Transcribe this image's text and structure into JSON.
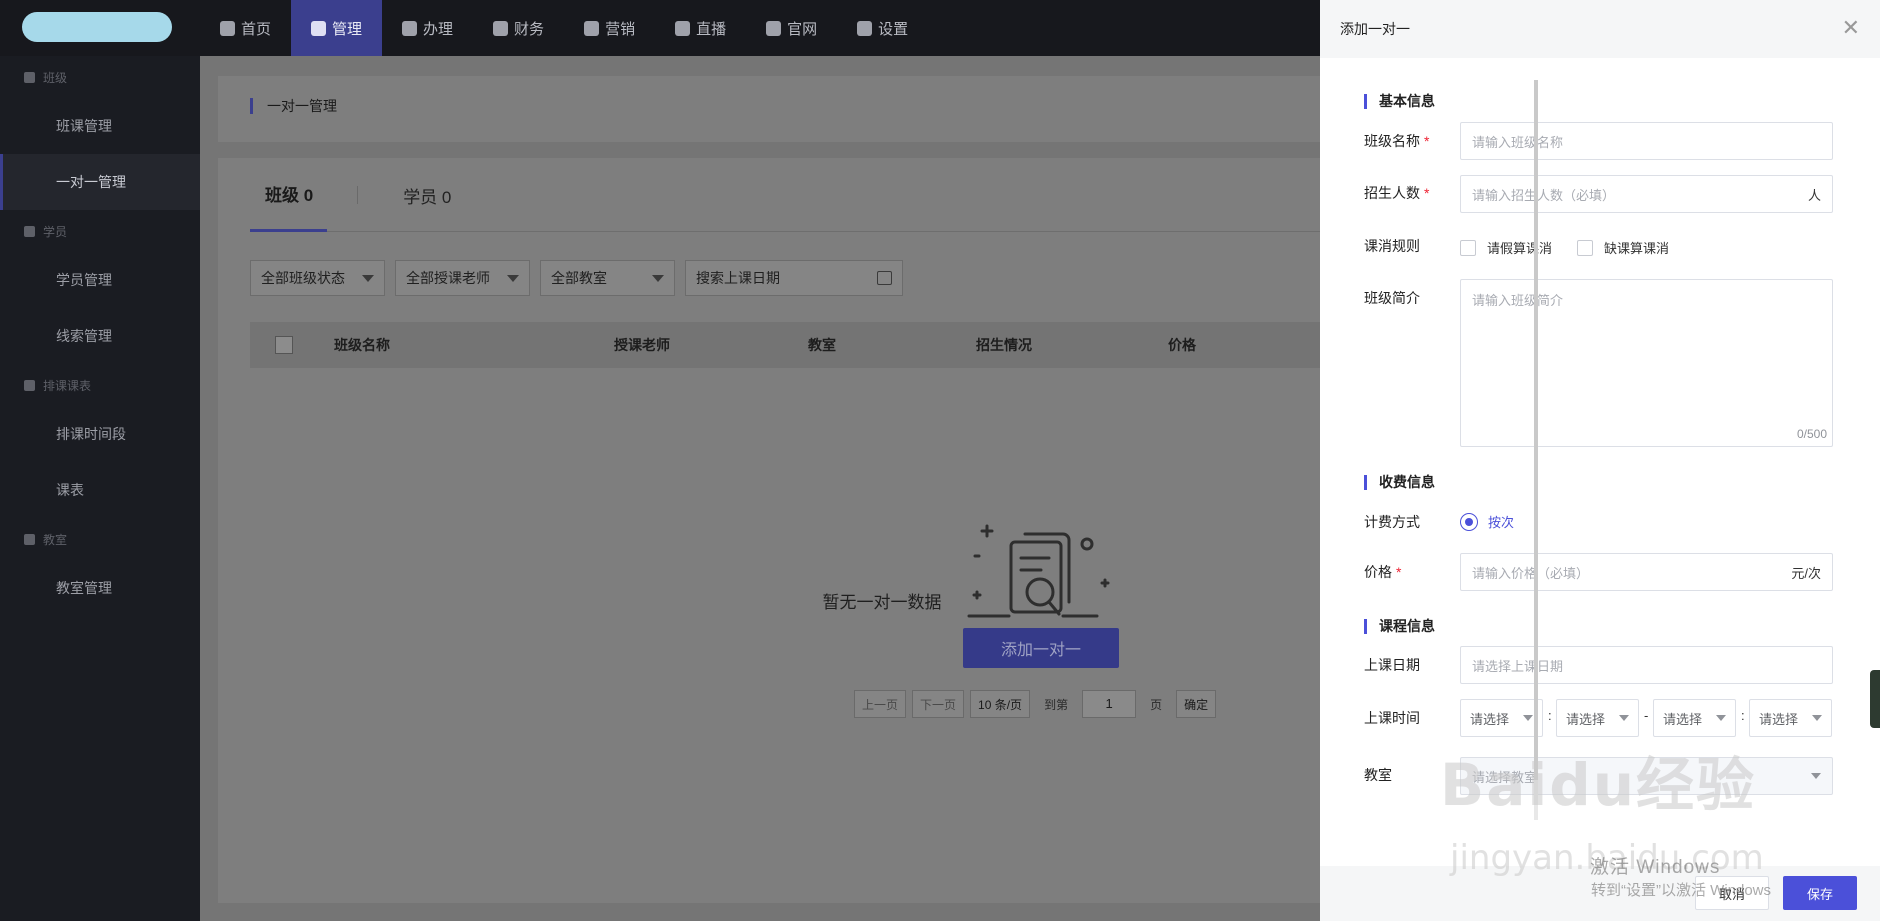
{
  "topnav": {
    "items": [
      {
        "label": "首页",
        "icon": "home-icon"
      },
      {
        "label": "管理",
        "icon": "shield-icon",
        "active": true
      },
      {
        "label": "办理",
        "icon": "graduation-cap-icon"
      },
      {
        "label": "财务",
        "icon": "money-bag-icon"
      },
      {
        "label": "营销",
        "icon": "marketing-icon"
      },
      {
        "label": "直播",
        "icon": "live-tv-icon"
      },
      {
        "label": "官网",
        "icon": "monitor-icon"
      },
      {
        "label": "设置",
        "icon": "gear-icon"
      }
    ]
  },
  "sidebar": {
    "groups": [
      {
        "label": "班级",
        "icon": "class-icon",
        "items": [
          "班课管理",
          "一对一管理"
        ]
      },
      {
        "label": "学员",
        "icon": "user-icon",
        "items": [
          "学员管理",
          "线索管理"
        ]
      },
      {
        "label": "排课课表",
        "icon": "calendar-icon",
        "items": [
          "排课时间段",
          "课表"
        ]
      },
      {
        "label": "教室",
        "icon": "door-icon",
        "items": [
          "教室管理"
        ]
      }
    ],
    "active_item": "一对一管理"
  },
  "main": {
    "breadcrumb": "一对一管理",
    "tabs": [
      "班级 0",
      "学员 0"
    ],
    "filters": {
      "class_status": "全部班级状态",
      "teacher": "全部授课老师",
      "classroom": "全部教室",
      "date_placeholder": "搜索上课日期"
    },
    "table_headers": [
      "班级名称",
      "授课老师",
      "教室",
      "招生情况",
      "价格"
    ],
    "empty_text": "暂无一对一数据",
    "add_button": "添加一对一",
    "pager": {
      "prev": "上一页",
      "next": "下一页",
      "page_size": "10 条/页",
      "goto_label": "到第",
      "page_value": "1",
      "page_unit": "页",
      "confirm": "确定"
    }
  },
  "drawer": {
    "title": "添加一对一",
    "sections": {
      "basic": "基本信息",
      "fee": "收费信息",
      "course": "课程信息"
    },
    "fields": {
      "class_name": {
        "label": "班级名称",
        "placeholder": "请输入班级名称",
        "required": "*"
      },
      "enroll_count": {
        "label": "招生人数",
        "placeholder": "请输入招生人数（必填）",
        "suffix": "人",
        "required": "*"
      },
      "deduct_rule": {
        "label": "课消规则",
        "options": [
          "请假算课消",
          "缺课算课消"
        ]
      },
      "intro": {
        "label": "班级简介",
        "placeholder": "请输入班级简介",
        "counter": "0/500"
      },
      "billing": {
        "label": "计费方式",
        "option": "按次"
      },
      "price": {
        "label": "价格",
        "placeholder": "请输入价格（必填）",
        "suffix": "元/次",
        "required": "*"
      },
      "class_date": {
        "label": "上课日期",
        "placeholder": "请选择上课日期"
      },
      "class_time": {
        "label": "上课时间",
        "selects": [
          "请选择",
          "请选择",
          "请选择",
          "请选择"
        ],
        "sep1": ":",
        "sep2": "-",
        "sep3": ":"
      },
      "classroom": {
        "label": "教室",
        "placeholder": "请选择教室"
      }
    },
    "cancel": "取消",
    "save": "保存"
  },
  "watermark": {
    "windows_line1": "激活 Windows",
    "windows_line2": "转到“设置”以激活 Windows",
    "baidu": "Baidu经验",
    "baidu_url": "jingyan.baidu.com"
  }
}
